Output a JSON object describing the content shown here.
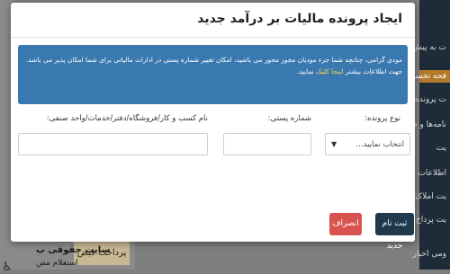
{
  "modal": {
    "title": "ایجاد پرونده مالیات بر درآمد جدید",
    "alert": {
      "text": "مودی گرامی، چنانچه شما جزء مودیان مجوز محور می باشید، امکان تغییر شماره پستی در ادارات مالیاتی برای شما امکان پذیر می باشد. جهت اطلاعات بیشتر",
      "link": "اینجا کلیک",
      "suffix": "نمایید."
    },
    "fields": {
      "tax_file_type_label": "نوع پرونده:",
      "tax_file_type_value": "انتخاب نمایید...",
      "postal_code_label": "شماره پستی:",
      "postal_code_value": "",
      "business_name_label": "نام کسب و کار/فروشگاه/دفتر/خدمات/واحد صنفی:",
      "business_name_value": ""
    },
    "buttons": {
      "submit": "ثبت نام جدید",
      "cancel": "انصراف"
    }
  },
  "background": {
    "sidebar": [
      "ت به پیش",
      "فحه نخست",
      "ت پرونده",
      "نامه‌ها و م",
      "یت",
      "اطلاعات صورت",
      "یت املاک",
      "یت پرداخ",
      "ومی اخبار"
    ],
    "pay_button": "پرداخت قبض",
    "logo_text": "سایت حقوقی پ",
    "logo_sub": "استعلام مص"
  },
  "colors": {
    "alert_bg": "#3a79b0",
    "submit_bg": "#1f3a4d",
    "cancel_bg": "#d9534f",
    "sidebar_bg": "#1e2b39"
  }
}
